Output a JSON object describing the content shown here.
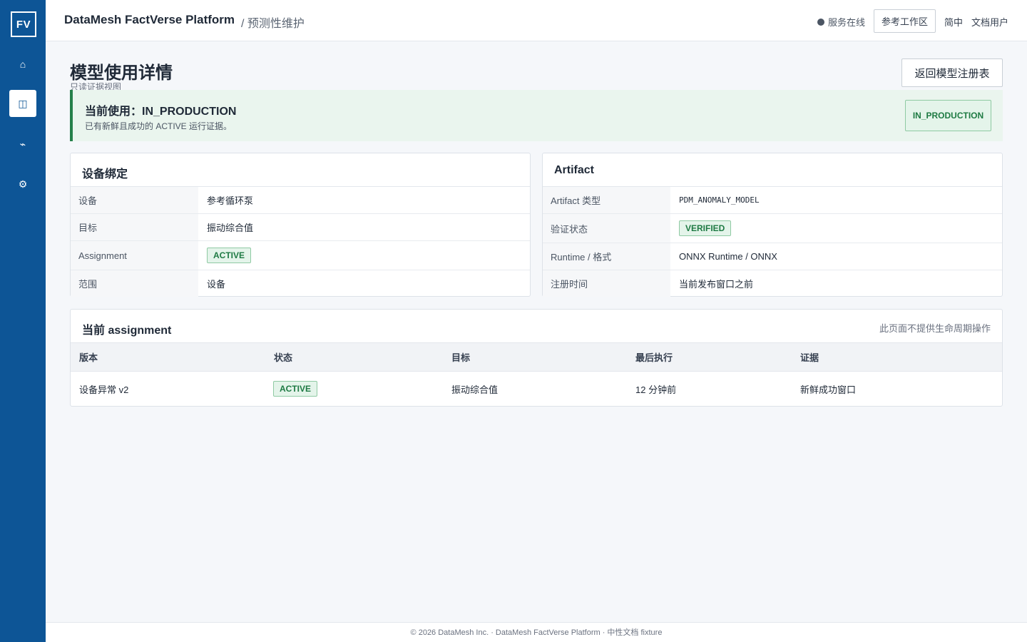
{
  "sidebar": {
    "logo": "FV",
    "items": [
      {
        "icon": "home-icon",
        "glyph": "⌂"
      },
      {
        "icon": "registry-icon",
        "glyph": "◫"
      },
      {
        "icon": "pulse-icon",
        "glyph": "⌁"
      },
      {
        "icon": "gear-icon",
        "glyph": "⚙"
      }
    ]
  },
  "header": {
    "brand": "DataMesh FactVerse Platform",
    "breadcrumb": "/ 预测性维护",
    "status": "服务在线",
    "workspace_button": "参考工作区",
    "language": "简中",
    "user": "文档用户"
  },
  "page": {
    "title": "模型使用详情",
    "subtitle": "只读证据视图",
    "back_button": "返回模型注册表"
  },
  "banner": {
    "title": "当前使用：IN_PRODUCTION",
    "subtitle": "已有新鲜且成功的 ACTIVE 运行证据。",
    "badge": "IN_PRODUCTION"
  },
  "device_card": {
    "title": "设备绑定",
    "rows": [
      {
        "key": "设备",
        "value": "参考循环泵"
      },
      {
        "key": "目标",
        "value": "振动综合值"
      },
      {
        "key": "Assignment",
        "value": "ACTIVE"
      },
      {
        "key": "范围",
        "value": "设备"
      }
    ]
  },
  "artifact_card": {
    "title": "Artifact",
    "rows": [
      {
        "key": "Artifact 类型",
        "value": "PDM_ANOMALY_MODEL"
      },
      {
        "key": "验证状态",
        "value": "VERIFIED"
      },
      {
        "key": "Runtime / 格式",
        "value": "ONNX Runtime / ONNX"
      },
      {
        "key": "注册时间",
        "value": "当前发布窗口之前"
      }
    ]
  },
  "assignment": {
    "title": "当前 assignment",
    "note": "此页面不提供生命周期操作",
    "columns": [
      "版本",
      "状态",
      "目标",
      "最后执行",
      "证据"
    ],
    "rows": [
      {
        "version": "设备异常 v2",
        "status": "ACTIVE",
        "target": "振动综合值",
        "last_run": "12 分钟前",
        "evidence": "新鲜成功窗口"
      }
    ]
  },
  "footer": "© 2026 DataMesh Inc. · DataMesh FactVerse Platform · 中性文档 fixture",
  "colors": {
    "sidebar": "#0d5596",
    "success": "#1e7a43",
    "banner_bg": "#eaf5ee"
  }
}
